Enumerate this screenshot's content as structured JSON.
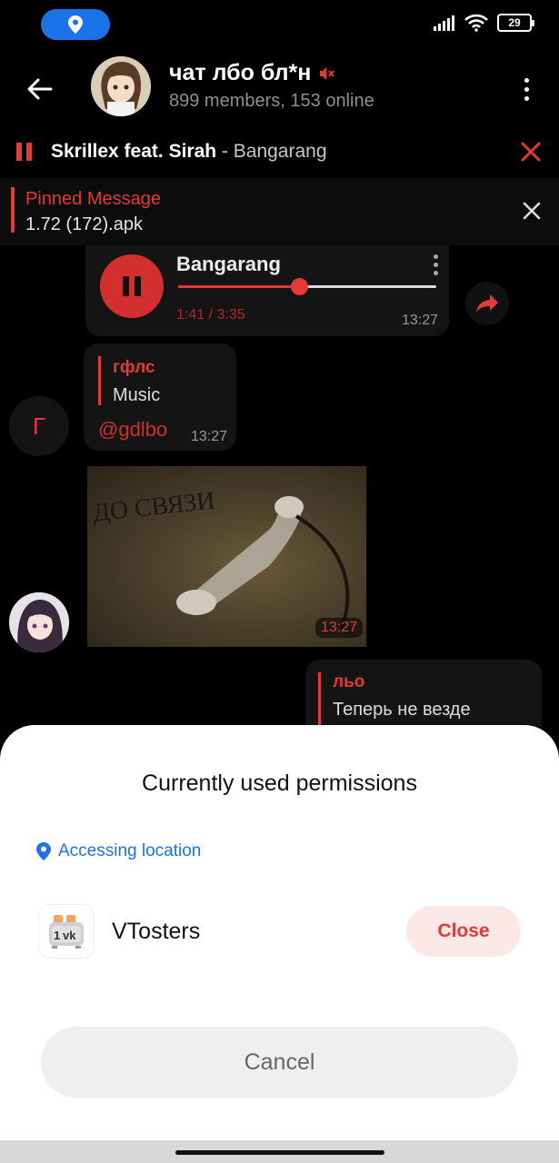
{
  "status_bar": {
    "battery": "29"
  },
  "header": {
    "title": "чат лбо бл*н",
    "subtitle": "899 members, 153 online"
  },
  "music_bar": {
    "artist": "Skrillex feat. Sirah",
    "separator": " - ",
    "song": "Bangarang"
  },
  "pinned": {
    "title": "Pinned Message",
    "text": "1.72 (172).apk"
  },
  "messages": {
    "audio": {
      "title": "Bangarang",
      "time": "1:41 / 3:35",
      "stamp": "13:27",
      "progress": 0.47
    },
    "reply": {
      "name": "гфлс",
      "text": "Music",
      "mention": "@gdlbo",
      "stamp": "13:27"
    },
    "g_avatar_letter": "Г",
    "photo": {
      "caption": "ДО СВЯЗИ",
      "stamp": "13:27"
    },
    "reply2": {
      "name": "льо",
      "text": "Теперь не везде"
    }
  },
  "sheet": {
    "title": "Currently used permissions",
    "location_label": "Accessing location",
    "app_name": "VTosters",
    "close_label": "Close",
    "cancel_label": "Cancel"
  },
  "colors": {
    "accent": "#e53935",
    "location_blue": "#1a73e8"
  }
}
